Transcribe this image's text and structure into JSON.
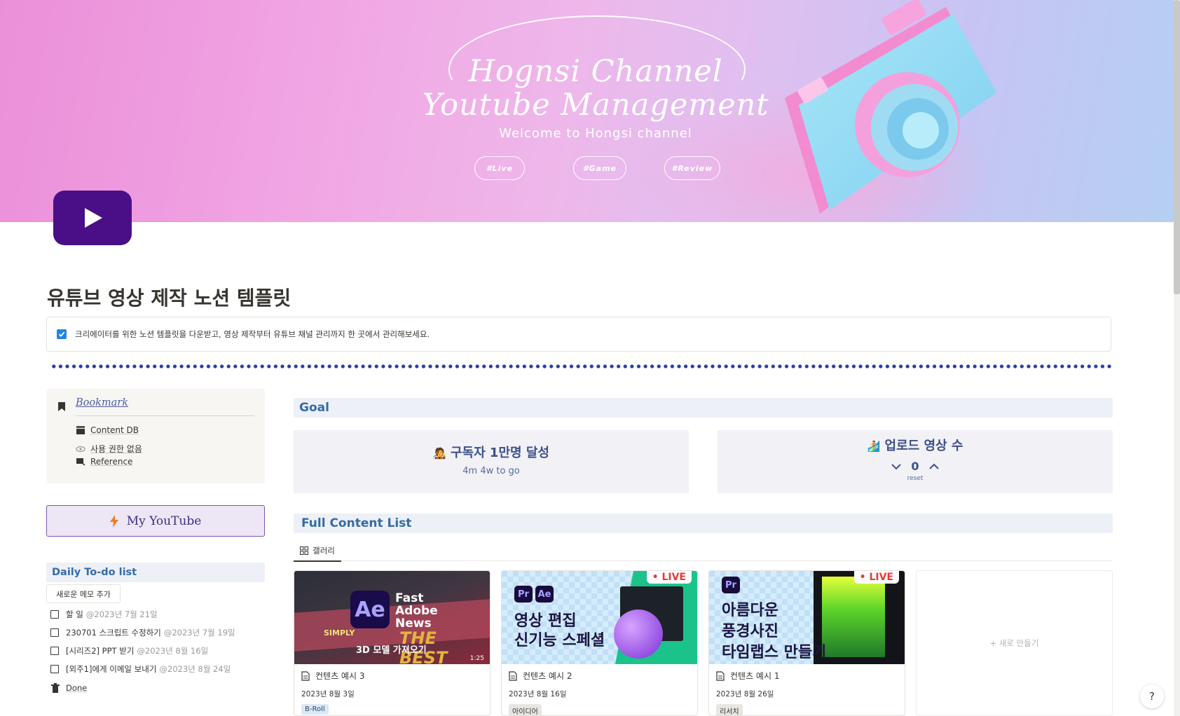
{
  "cover": {
    "title_line1": "Hognsi Channel",
    "title_line2": "Youtube Management",
    "subtitle": "Welcome to Hongsi channel",
    "tags": [
      "#Live",
      "#Game",
      "#Review"
    ]
  },
  "page": {
    "title": "유튜브 영상 제작 노션 템플릿",
    "callout_text": "크리에이터를 위한 노션 템플릿을 다운받고, 영상 제작부터 유튜브 채널 관리까지 한 곳에서 관리해보세요."
  },
  "bookmark": {
    "title": "Bookmark",
    "items": [
      {
        "label": "Content DB",
        "icon": "clapper-icon"
      },
      {
        "label": "사용 권한 없음",
        "icon": "eye-icon"
      },
      {
        "label": "Reference",
        "icon": "link-icon"
      }
    ]
  },
  "my_youtube": {
    "label": "My YouTube"
  },
  "todo": {
    "title": "Daily To-do list",
    "new_button": "새로운 메모 추가",
    "items": [
      {
        "text": "할 일",
        "date": "@2023년 7월 21일"
      },
      {
        "text": "230701 스크립트 수정하기",
        "date": "@2023년 7월 19일"
      },
      {
        "text": "[시리즈2] PPT 받기",
        "date": "@2023년 8월 16일"
      },
      {
        "text": "[외주1]에게 이메일 보내기",
        "date": "@2023년 8월 24일"
      }
    ],
    "done_label": "Done"
  },
  "goal": {
    "title": "Goal",
    "card1": {
      "emoji": "🧑‍🎤",
      "title": "구독자 1만명 달성",
      "subtitle": "4m 4w to go"
    },
    "card2": {
      "emoji": "🏄",
      "title": "업로드 영상 수",
      "count": "0",
      "reset": "reset"
    }
  },
  "content": {
    "title": "Full Content List",
    "tab_label": "갤러리",
    "cards": [
      {
        "name": "컨텐츠 예시 3",
        "date": "2023년 8월 3일",
        "tag": "B-Roll",
        "tag_bg": "#dbe8f3",
        "tag_fg": "#2b4a6b",
        "thumb": {
          "badge1": "Ae",
          "line1": "Fast",
          "line2": "Adobe",
          "line3": "News",
          "small": "SIMPLY",
          "best": "THE BEST",
          "bottom": "3D 모델 가져오기",
          "time": "1:25"
        }
      },
      {
        "name": "컨텐츠 예시 2",
        "date": "2023년 8월 16일",
        "tag": "아이디어",
        "tag_bg": "#e7e6e3",
        "tag_fg": "#37352f",
        "thumb": {
          "badge1": "Pr",
          "badge2": "Ae",
          "line1": "영상 편집",
          "line2": "신기능 스페셜",
          "live": "• LIVE"
        }
      },
      {
        "name": "컨텐츠 예시 1",
        "date": "2023년 8월 26일",
        "tag": "리서치",
        "tag_bg": "#e7e6e3",
        "tag_fg": "#37352f",
        "thumb": {
          "badge1": "Pr",
          "line1": "아름다운",
          "line2": "풍경사진",
          "line3": "타임랩스 만들기",
          "live": "• LIVE"
        }
      }
    ],
    "new_label": "+ 새로 만들기"
  },
  "help": {
    "label": "?"
  },
  "colors": {
    "accent": "#356ba6",
    "brand_purple": "#4a0f86",
    "checkbox": "#2383e2"
  }
}
